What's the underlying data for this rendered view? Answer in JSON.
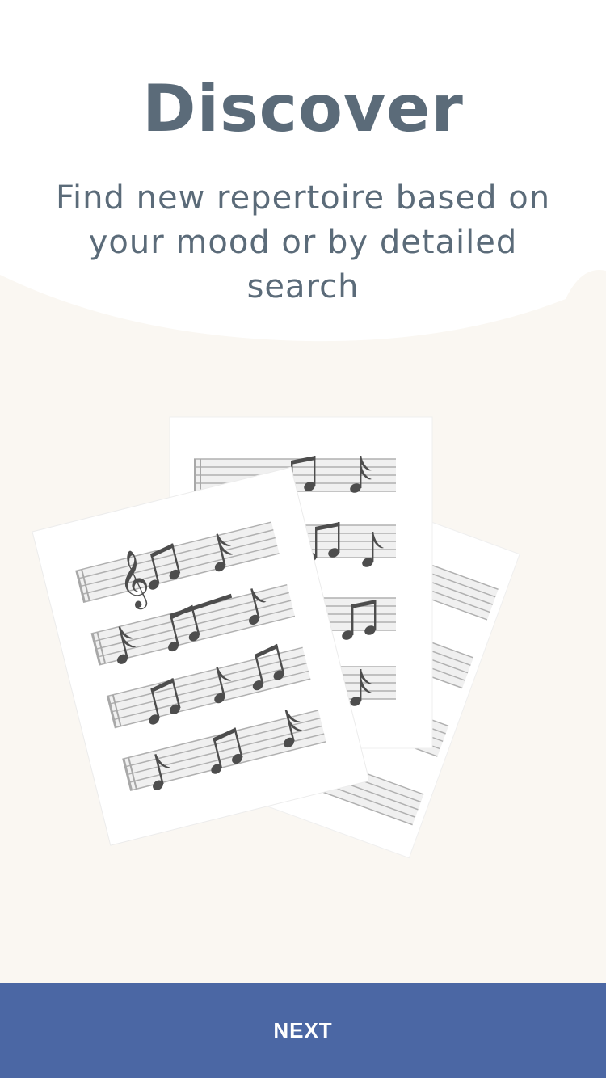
{
  "onboarding": {
    "title": "Discover",
    "subtitle": "Find new repertoire based on your mood or by detailed search",
    "next_label": "NEXT"
  },
  "illustration": {
    "icon": "sheet-music-illustration",
    "sheets": [
      "sheet-back-right",
      "sheet-back-center",
      "sheet-front-left"
    ]
  },
  "colors": {
    "background": "#faf7f2",
    "text": "#5b6b79",
    "button": "#4b67a4",
    "button_text": "#ffffff",
    "note": "#4d4d4d"
  }
}
